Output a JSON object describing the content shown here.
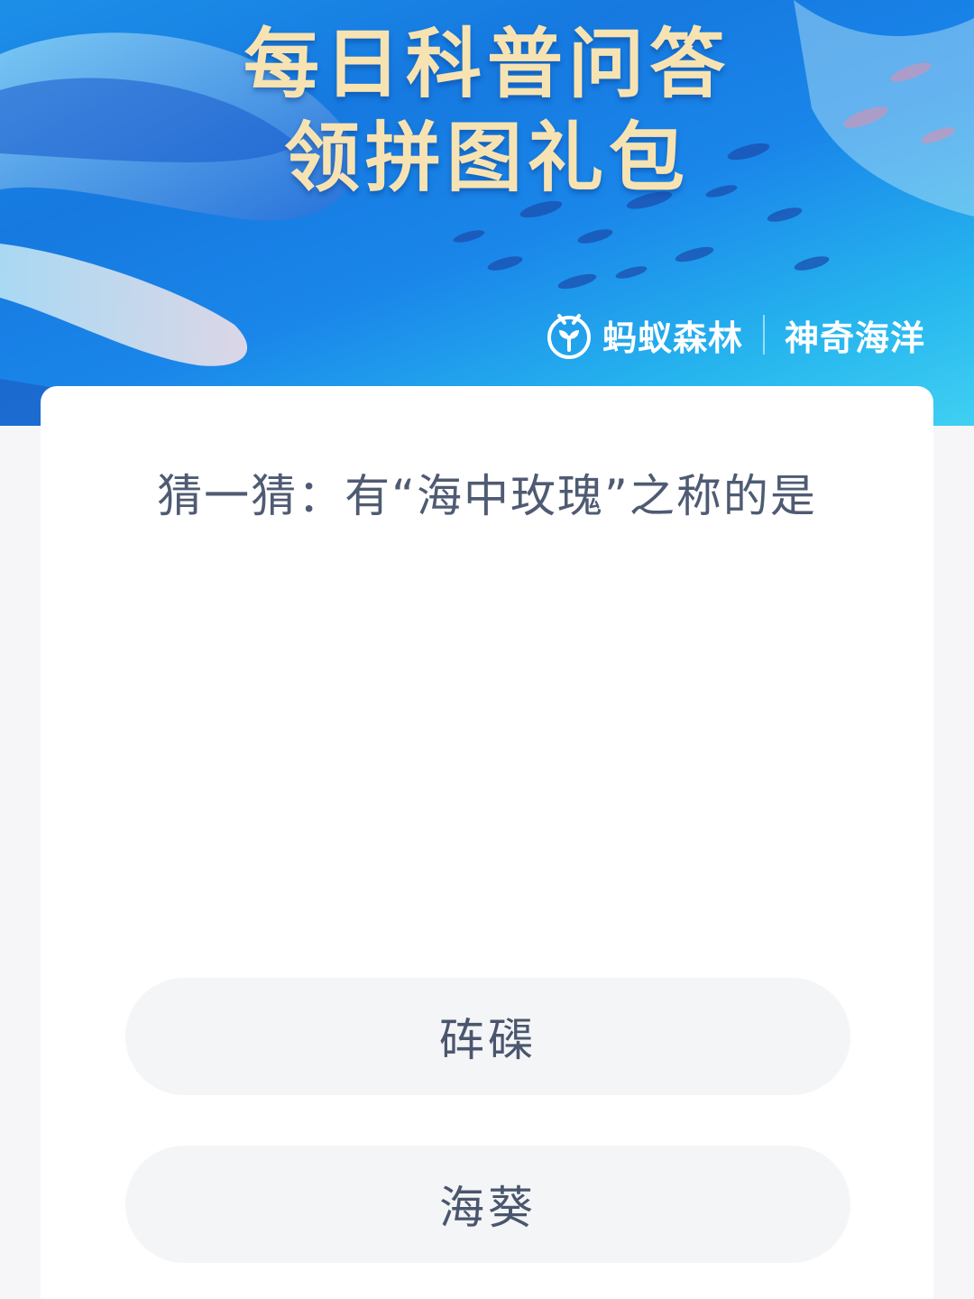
{
  "banner": {
    "title_line1": "每日科普问答",
    "title_line2": "领拼图礼包",
    "brand_name": "蚂蚁森林",
    "brand_subtitle": "神奇海洋",
    "logo_icon": "ant-forest-sprout-icon"
  },
  "quiz": {
    "question": "猜一猜：有“海中玫瑰”之称的是",
    "options": [
      {
        "label": "砗磲"
      },
      {
        "label": "海葵"
      }
    ]
  },
  "colors": {
    "banner_blue": "#1a86ea",
    "title_gold": "#f7e3b2",
    "text_gray": "#4f5b73",
    "option_bg": "#f4f5f7",
    "page_bg": "#f6f6f8"
  }
}
